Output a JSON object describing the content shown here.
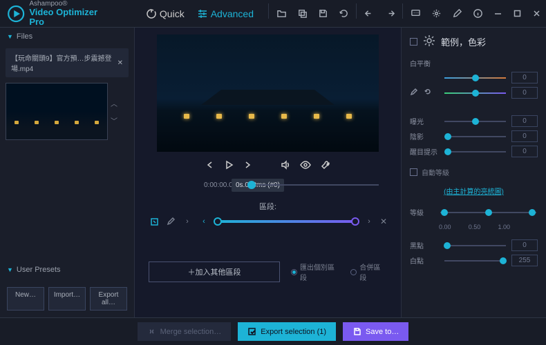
{
  "brand": {
    "company": "Ashampoo®",
    "product": "Video Optimizer Pro"
  },
  "modes": {
    "quick": "Quick",
    "advanced": "Advanced"
  },
  "sidebar": {
    "files_header": "Files",
    "file_name": "【玩命關頭9】官方預…步震撼登場.mp4",
    "presets_header": "User Presets",
    "btn_new": "New…",
    "btn_import": "Import…",
    "btn_export": "Export all…"
  },
  "preview": {
    "timestamp_tooltip": "0s.000ms (#0)",
    "timestamp": "0:00:00.000"
  },
  "segments": {
    "title": "區段:",
    "add_btn": "＋加入其他區段",
    "radio1": "匯出個別區段",
    "radio2": "合併區段"
  },
  "right": {
    "title": "範例，色彩",
    "wb": "白平衡",
    "exposure": "曝光",
    "shadows": "陰影",
    "highlights": "醒目提示",
    "auto": "自動等級",
    "link": "(由主計算的亮統圖)",
    "level": "等級",
    "blackpt": "黑點",
    "whitept": "白點",
    "v0": "0",
    "v255": "255",
    "lv0": "0.00",
    "lv05": "0.50",
    "lv1": "1.00"
  },
  "footer": {
    "merge": "Merge selection…",
    "export": "Export selection (1)",
    "save": "Save to…"
  }
}
